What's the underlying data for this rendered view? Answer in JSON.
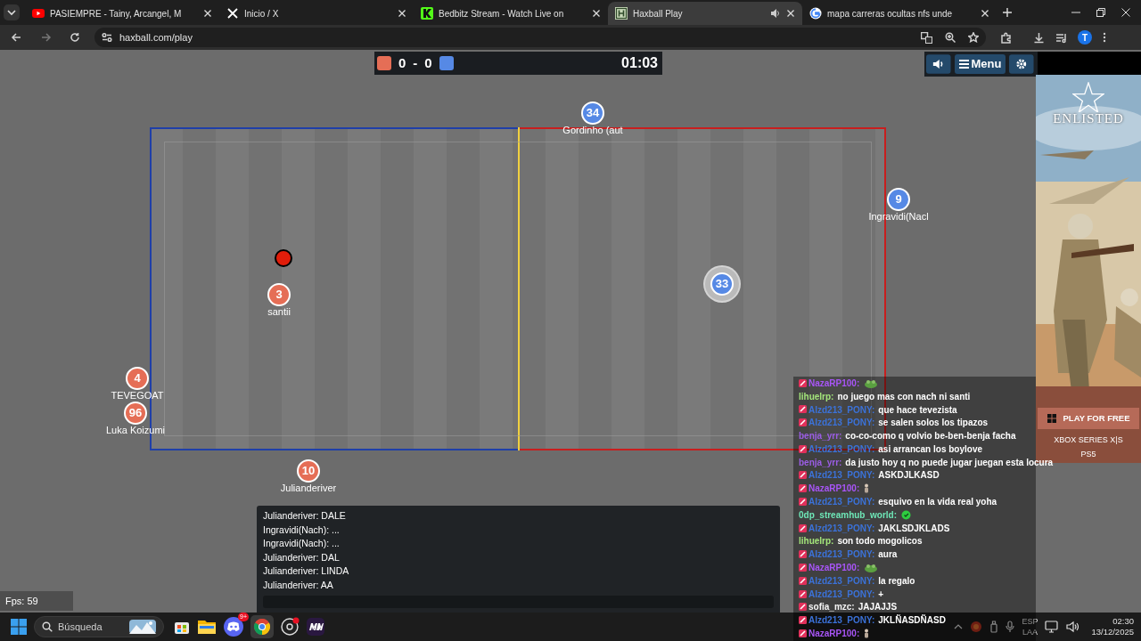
{
  "browser": {
    "tabs": [
      {
        "title": "PASIEMPRE - Tainy, Arcangel, M",
        "selected": false,
        "audio": false
      },
      {
        "title": "Inicio / X",
        "selected": false,
        "audio": false
      },
      {
        "title": "Bedbitz Stream - Watch Live on",
        "selected": false,
        "audio": false
      },
      {
        "title": "Haxball Play",
        "selected": true,
        "audio": true
      },
      {
        "title": "mapa carreras ocultas nfs unde",
        "selected": false,
        "audio": false
      }
    ],
    "address": "haxball.com/play",
    "profile": "T"
  },
  "scoreboard": {
    "red_score": "0",
    "separator": "-",
    "blue_score": "0",
    "time": "01:03"
  },
  "controls": {
    "menu": "Menu"
  },
  "players": [
    {
      "number": "34",
      "name": "Gordinho (aut",
      "color": "#5689e5",
      "highlighted": false
    },
    {
      "number": "9",
      "name": "Ingravidi(Nacl",
      "color": "#5689e5",
      "highlighted": false
    },
    {
      "number": "3",
      "name": "santii",
      "color": "#e56e56",
      "highlighted": false
    },
    {
      "number": "33",
      "color": "#5689e5",
      "highlighted": true
    },
    {
      "number": "4",
      "name": "TEVEGOAT",
      "color": "#e56e56",
      "highlighted": false
    },
    {
      "number": "96",
      "name": "Luka Koizumi",
      "color": "#e56e56",
      "highlighted": false
    },
    {
      "number": "10",
      "name": "Julianderiver",
      "color": "#e56e56",
      "highlighted": false
    }
  ],
  "room_chat": {
    "messages": [
      "Julianderiver: DALE",
      "Ingravidi(Nach): ...",
      "Ingravidi(Nach): ...",
      "Julianderiver: DAL",
      "Julianderiver: LINDA",
      "Julianderiver: AA"
    ]
  },
  "fps": "Fps: 59",
  "ad": {
    "logo": "ENLISTED",
    "button": "PLAY FOR FREE",
    "platforms": [
      "XBOX SERIES X|S",
      "PS5"
    ]
  },
  "stream_chat": [
    {
      "user": "NazaRP100:",
      "color": "#a855f7",
      "badge": true,
      "kind": "emote"
    },
    {
      "user": "lihuelrp:",
      "color": "#a3e47a",
      "badge": false,
      "kind": "text",
      "text": "no juego mas con nach ni santi"
    },
    {
      "user": "Alzd213_PONY:",
      "color": "#3b72d9",
      "badge": true,
      "kind": "text",
      "text": "que hace tevezista"
    },
    {
      "user": "Alzd213_PONY:",
      "color": "#3b72d9",
      "badge": true,
      "kind": "text",
      "text": "se salen solos los tipazos"
    },
    {
      "user": "benja_yrr:",
      "color": "#9b5de5",
      "badge": false,
      "kind": "text",
      "text": "co-co-como q volvio be-ben-benja facha"
    },
    {
      "user": "Alzd213_PONY:",
      "color": "#3b72d9",
      "badge": true,
      "kind": "text",
      "text": "asi arrancan los boylove"
    },
    {
      "user": "benja_yrr:",
      "color": "#9b5de5",
      "badge": false,
      "kind": "text",
      "text": "da justo hoy q no puede jugar juegan esta locura"
    },
    {
      "user": "Alzd213_PONY:",
      "color": "#3b72d9",
      "badge": true,
      "kind": "text",
      "text": "ASKDJLKASD"
    },
    {
      "user": "NazaRP100:",
      "color": "#a855f7",
      "badge": true,
      "kind": "emote"
    },
    {
      "user": "Alzd213_PONY:",
      "color": "#3b72d9",
      "badge": true,
      "kind": "text",
      "text": "esquivo en la vida real yoha"
    },
    {
      "user": "0dp_streamhub_world:",
      "color": "#6ee7b7",
      "badge": false,
      "kind": "emote"
    },
    {
      "user": "Alzd213_PONY:",
      "color": "#3b72d9",
      "badge": true,
      "kind": "text",
      "text": "JAKLSDJKLADS"
    },
    {
      "user": "lihuelrp:",
      "color": "#a3e47a",
      "badge": false,
      "kind": "text",
      "text": "son todo mogolicos"
    },
    {
      "user": "Alzd213_PONY:",
      "color": "#3b72d9",
      "badge": true,
      "kind": "text",
      "text": "aura"
    },
    {
      "user": "NazaRP100:",
      "color": "#a855f7",
      "badge": true,
      "kind": "emote"
    },
    {
      "user": "Alzd213_PONY:",
      "color": "#3b72d9",
      "badge": true,
      "kind": "text",
      "text": "la regalo"
    },
    {
      "user": "Alzd213_PONY:",
      "color": "#3b72d9",
      "badge": true,
      "kind": "text",
      "text": "+"
    },
    {
      "user": "sofia_mzc:",
      "color": "#f5f5f5",
      "badge": true,
      "kind": "text",
      "text": "JAJAJJS"
    },
    {
      "user": "Alzd213_PONY:",
      "color": "#3b72d9",
      "badge": true,
      "kind": "text",
      "text": "JKLÑASDÑASD"
    },
    {
      "user": "NazaRP100:",
      "color": "#a855f7",
      "badge": true,
      "kind": "emote"
    }
  ],
  "taskbar": {
    "placeholder": "Búsqueda",
    "discord_badge": "9+",
    "language": [
      "ESP",
      "LAA"
    ],
    "time": "02:30",
    "date": "13/12/2025"
  }
}
